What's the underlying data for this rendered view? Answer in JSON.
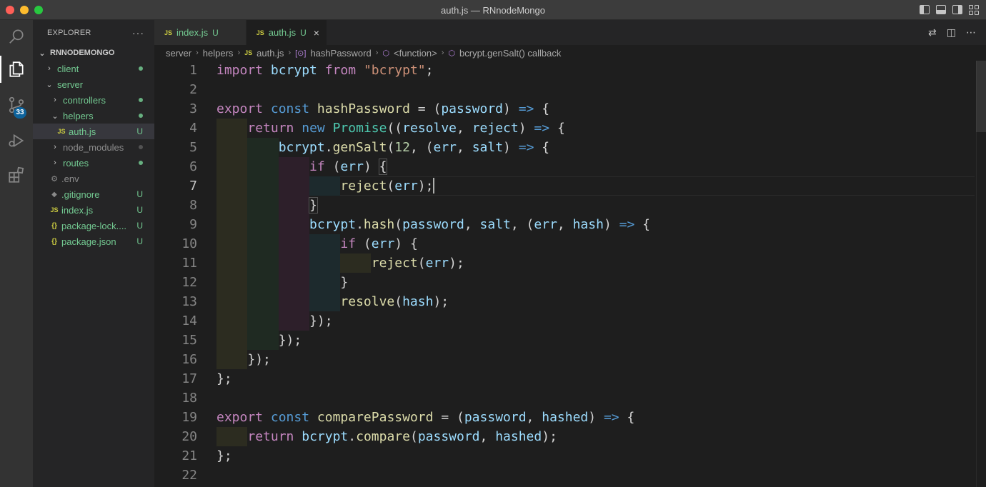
{
  "window": {
    "title": "auth.js — RNnodeMongo"
  },
  "activity": {
    "scm_badge": "33"
  },
  "sidebar": {
    "header": "EXPLORER",
    "more": "···",
    "root": "RNNODEMONGO",
    "items": [
      {
        "label": "client",
        "chevron": "›",
        "status": "dot"
      },
      {
        "label": "server",
        "chevron": "⌄",
        "status": ""
      },
      {
        "label": "controllers",
        "chevron": "›",
        "status": "dot"
      },
      {
        "label": "helpers",
        "chevron": "⌄",
        "status": "dot"
      },
      {
        "label": "auth.js",
        "icon": "JS",
        "status": "U"
      },
      {
        "label": "node_modules",
        "chevron": "›",
        "status": "dot"
      },
      {
        "label": "routes",
        "chevron": "›",
        "status": "dot"
      },
      {
        "label": ".env",
        "icon": "gear",
        "status": ""
      },
      {
        "label": ".gitignore",
        "icon": "git",
        "status": "U"
      },
      {
        "label": "index.js",
        "icon": "JS",
        "status": "U"
      },
      {
        "label": "package-lock....",
        "icon": "{}",
        "status": "U"
      },
      {
        "label": "package.json",
        "icon": "{}",
        "status": "U"
      }
    ]
  },
  "tabs": [
    {
      "icon": "JS",
      "name": "index.js",
      "status": "U"
    },
    {
      "icon": "JS",
      "name": "auth.js",
      "status": "U",
      "close": "×"
    }
  ],
  "breadcrumb": {
    "parts": [
      "server",
      "helpers",
      "auth.js",
      "hashPassword",
      "<function>",
      "bcrypt.genSalt() callback"
    ],
    "js_icon": "JS",
    "sym_icon": "[⊙]",
    "fn_icon": "⬡"
  },
  "editor": {
    "line_numbers": [
      "1",
      "2",
      "3",
      "4",
      "5",
      "6",
      "7",
      "8",
      "9",
      "10",
      "11",
      "12",
      "13",
      "14",
      "15",
      "16",
      "17",
      "18",
      "19",
      "20",
      "21",
      "22"
    ],
    "current_line": 7,
    "tokens": {
      "import": "import",
      "bcrypt": "bcrypt",
      "from": "from",
      "bcrypt_str": "\"bcrypt\"",
      "export": "export",
      "const": "const",
      "hashPassword": "hashPassword",
      "password": "password",
      "return": "return",
      "new": "new",
      "Promise": "Promise",
      "resolve": "resolve",
      "reject": "reject",
      "genSalt": "genSalt",
      "n12": "12",
      "err": "err",
      "salt": "salt",
      "if": "if",
      "hash": "hash",
      "comparePassword": "comparePassword",
      "hashed": "hashed",
      "compare": "compare"
    }
  }
}
